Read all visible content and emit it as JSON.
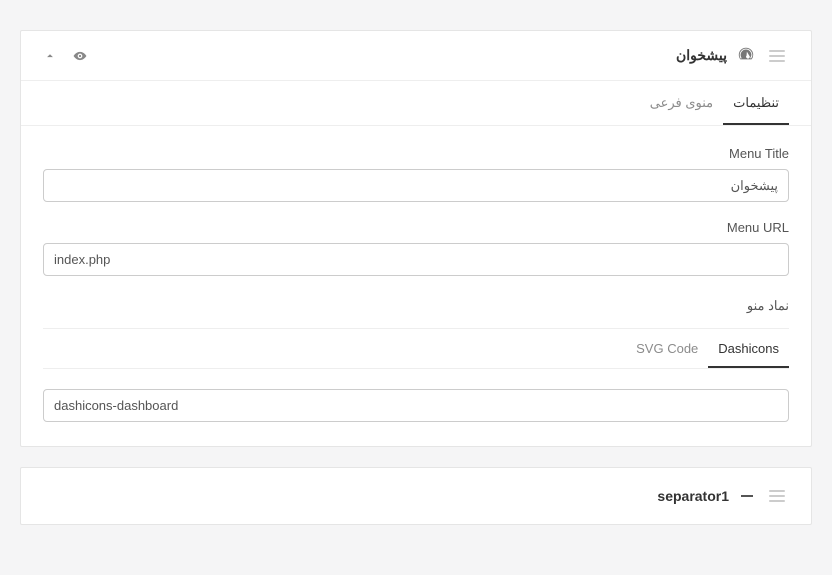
{
  "main": {
    "title": "پیشخوان",
    "tabs": {
      "settings": "تنظیمات",
      "submenu": "منوی فرعی"
    },
    "fields": {
      "menu_title_label": "Menu Title",
      "menu_title_value": "پیشخوان",
      "menu_url_label": "Menu URL",
      "menu_url_value": "index.php",
      "menu_icon_label": "نماد منو"
    },
    "icon_tabs": {
      "dashicons": "Dashicons",
      "svg": "SVG Code"
    },
    "icon_value": "dashicons-dashboard"
  },
  "separator": {
    "title": "separator1"
  }
}
